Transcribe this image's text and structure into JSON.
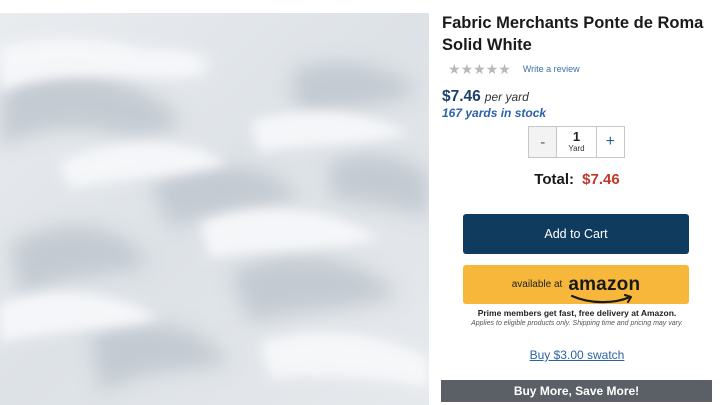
{
  "product": {
    "title": "Fabric Merchants Ponte de Roma Solid White",
    "rating_stars": 5,
    "rating_filled": 0,
    "write_review": "Write a review",
    "price": "$7.46",
    "unit": "per yard",
    "stock": "167 yards in stock"
  },
  "quantity": {
    "decrement": "-",
    "value": "1",
    "unit": "Yard",
    "increment": "+"
  },
  "total": {
    "label": "Total:",
    "value": "$7.46"
  },
  "buttons": {
    "add_to_cart": "Add to Cart",
    "amazon_prefix": "available at",
    "amazon_logo": "amazon",
    "swatch": "Buy $3.00 swatch",
    "buy_more": "Buy More, Save More!"
  },
  "notes": {
    "prime": "Prime members get fast, free delivery at Amazon.",
    "prime_sub": "Applies to eligible products only. Shipping time and pricing may vary."
  },
  "colors": {
    "price": "#1f3f6b",
    "stock": "#2a63a8",
    "total_value": "#c0392b",
    "add_to_cart_bg": "#0e3b5e",
    "amazon_bg": "#f6b73a",
    "buy_more_bg": "#5b6066"
  }
}
